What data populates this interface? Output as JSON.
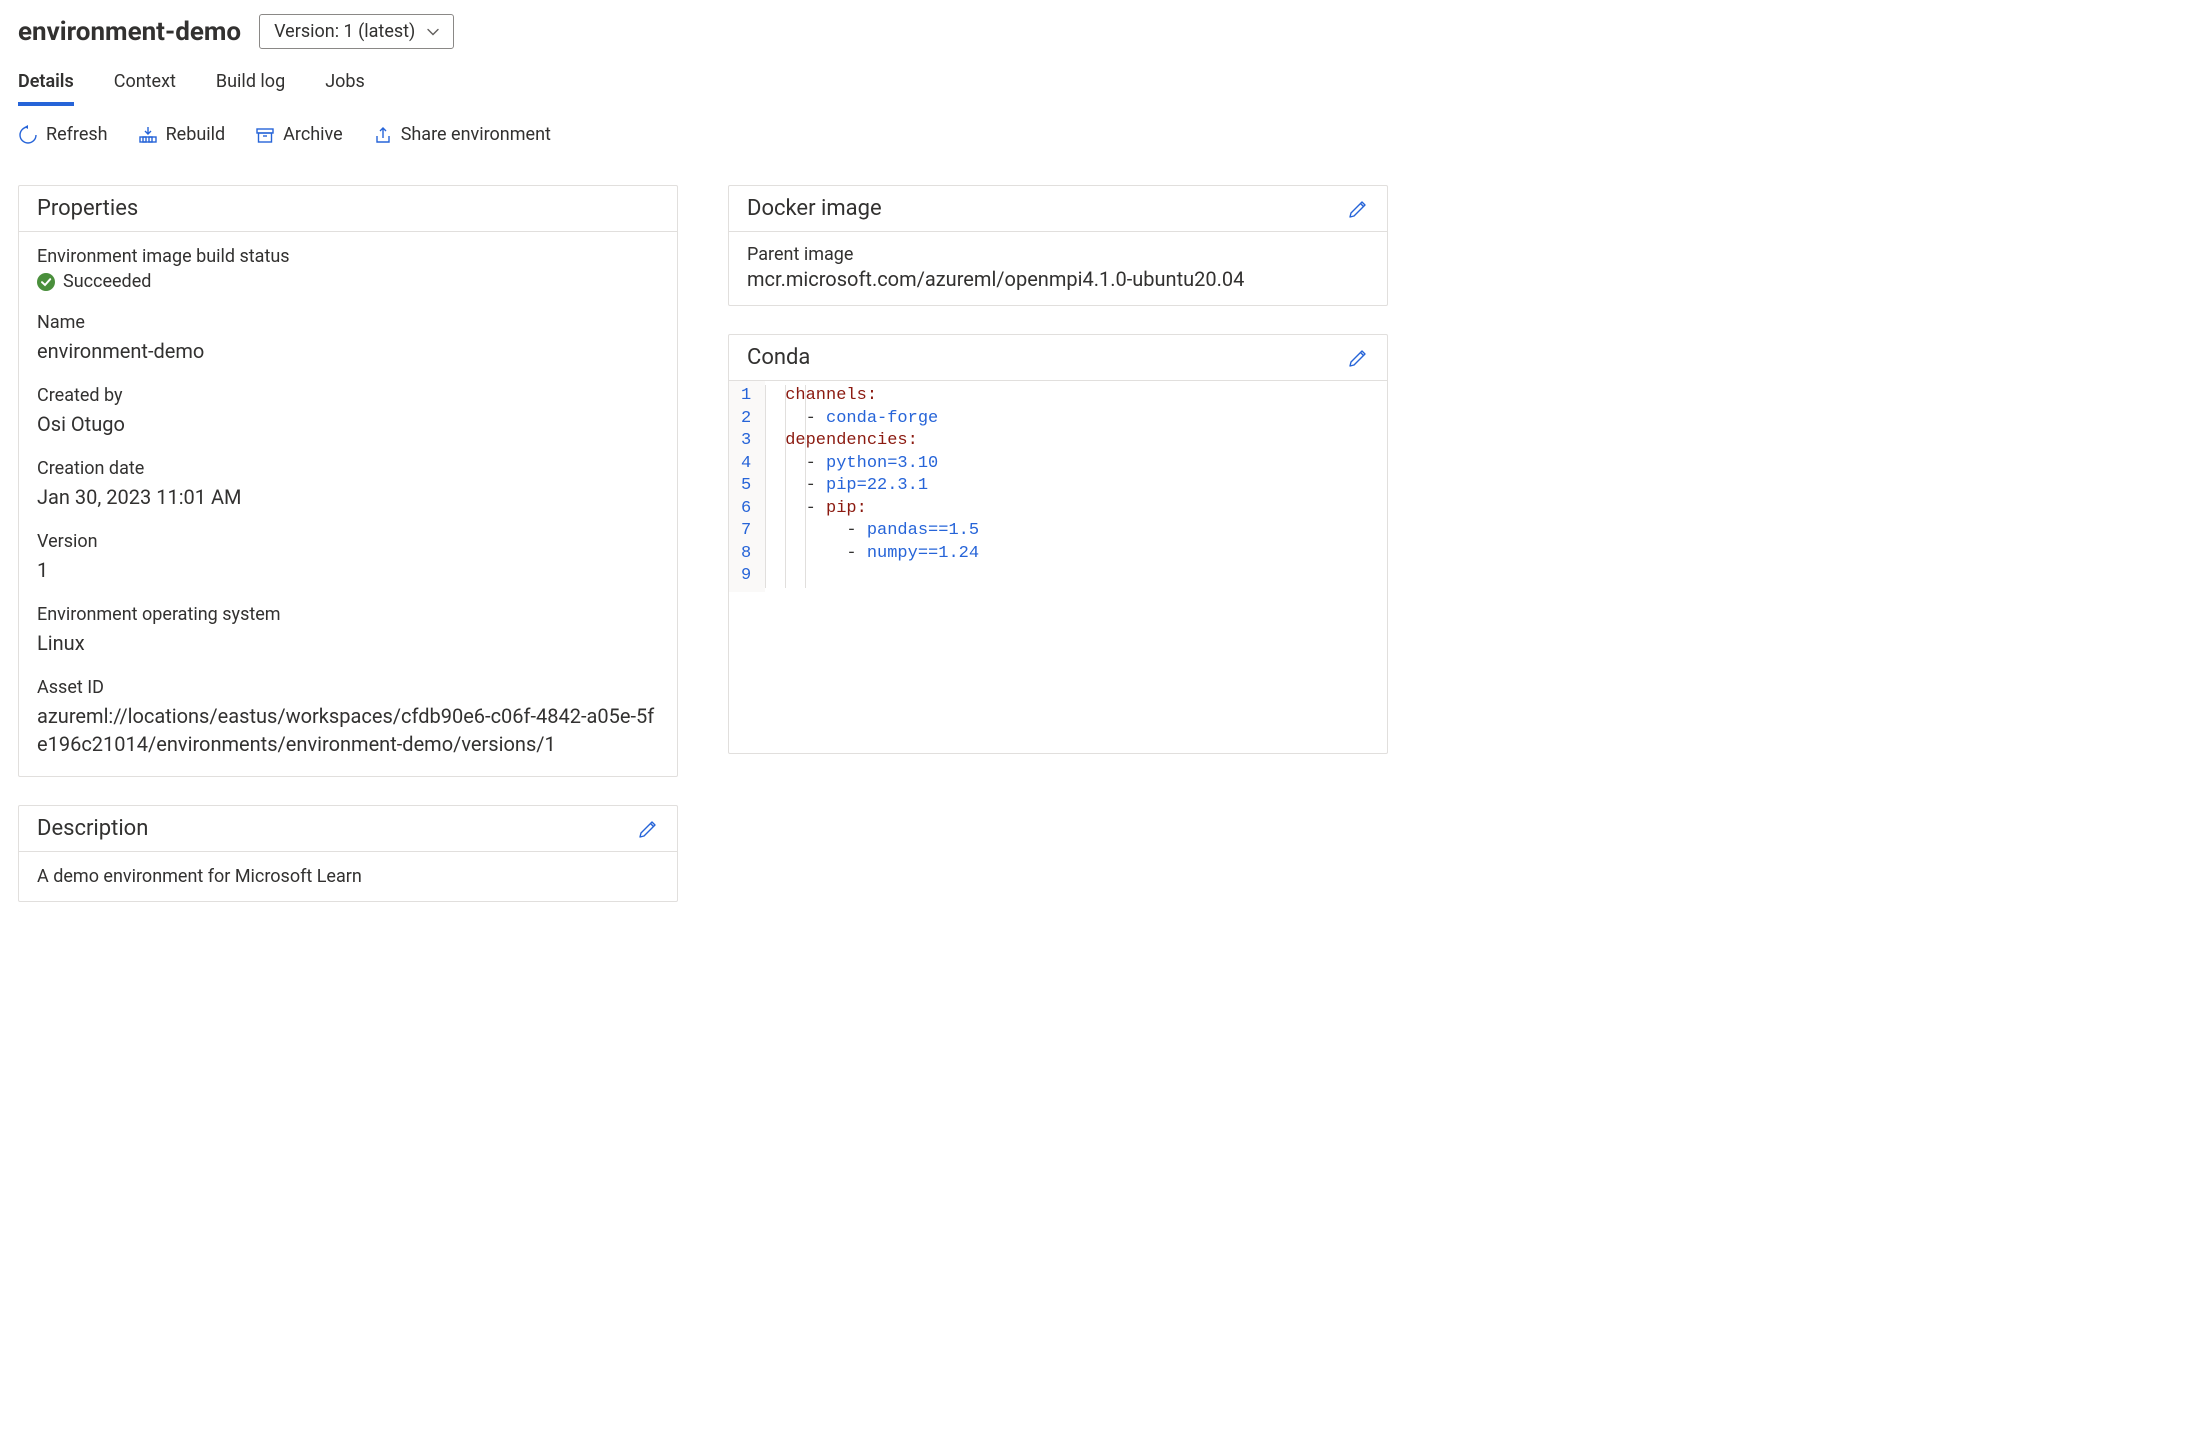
{
  "header": {
    "title": "environment-demo",
    "version_selector": "Version: 1 (latest)"
  },
  "tabs": {
    "details": "Details",
    "context": "Context",
    "build_log": "Build log",
    "jobs": "Jobs"
  },
  "toolbar": {
    "refresh": "Refresh",
    "rebuild": "Rebuild",
    "archive": "Archive",
    "share": "Share environment"
  },
  "properties": {
    "heading": "Properties",
    "build_status_label": "Environment image build status",
    "build_status_value": "Succeeded",
    "name_label": "Name",
    "name_value": "environment-demo",
    "created_by_label": "Created by",
    "created_by_value": "Osi Otugo",
    "creation_date_label": "Creation date",
    "creation_date_value": "Jan 30, 2023 11:01 AM",
    "version_label": "Version",
    "version_value": "1",
    "os_label": "Environment operating system",
    "os_value": "Linux",
    "asset_id_label": "Asset ID",
    "asset_id_value": "azureml://locations/eastus/workspaces/cfdb90e6-c06f-4842-a05e-5fe196c21014/environments/environment-demo/versions/1"
  },
  "description": {
    "heading": "Description",
    "value": "A demo environment for Microsoft Learn"
  },
  "docker": {
    "heading": "Docker image",
    "parent_label": "Parent image",
    "parent_value": "mcr.microsoft.com/azureml/openmpi4.1.0-ubuntu20.04"
  },
  "conda": {
    "heading": "Conda",
    "line_numbers": [
      "1",
      "2",
      "3",
      "4",
      "5",
      "6",
      "7",
      "8",
      "9"
    ],
    "tokens": {
      "channels": "channels",
      "conda_forge": "conda-forge",
      "dependencies": "dependencies",
      "python": "python=3.10",
      "pip_ver": "pip=22.3.1",
      "pip": "pip",
      "pandas": "pandas==1.5",
      "numpy": "numpy==1.24",
      "colon": ":",
      "dash": "- "
    }
  }
}
